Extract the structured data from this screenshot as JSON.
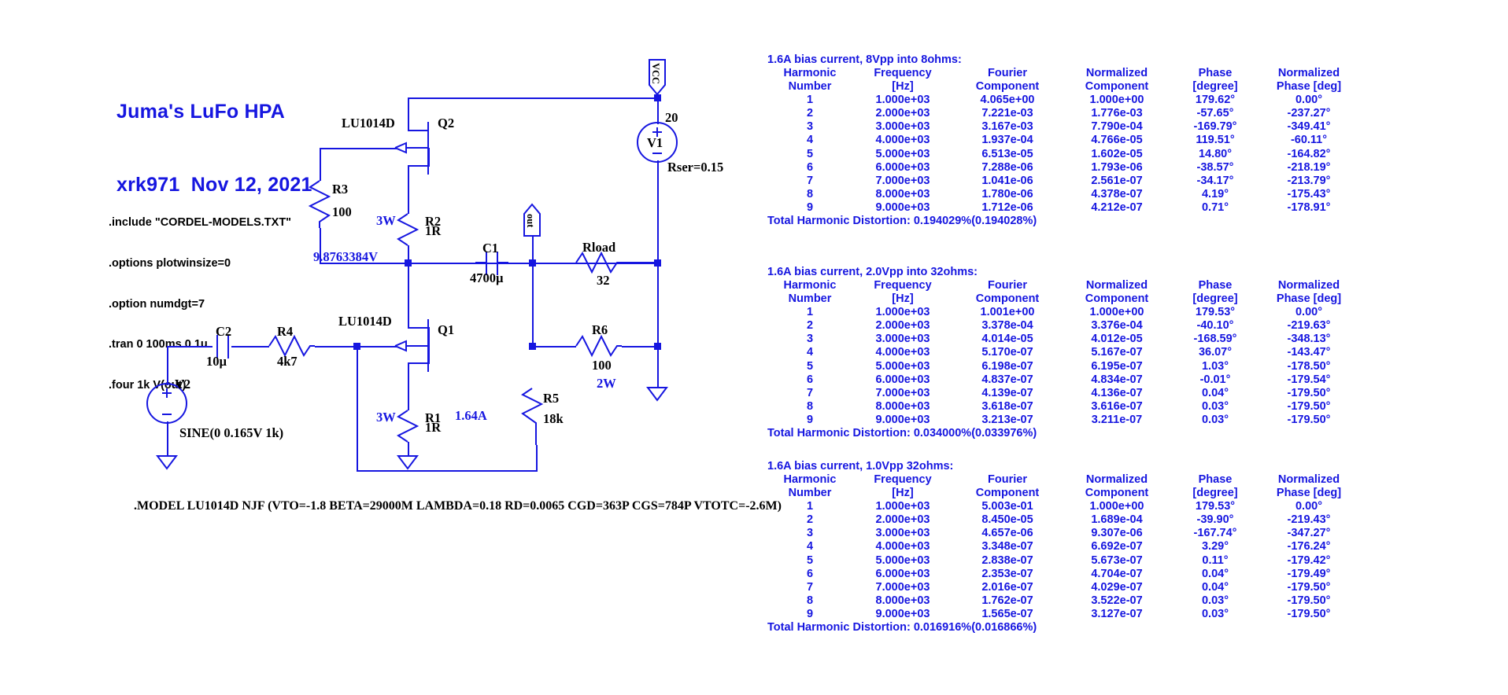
{
  "schematic": {
    "title_line1": "Juma's LuFo HPA",
    "title_line2": "xrk971  Nov 12, 2021",
    "directives": [
      ".include \"CORDEL-MODELS.TXT\"",
      ".options plotwinsize=0",
      ".option numdgt=7",
      ".tran 0 100ms 0 1u",
      ".four 1k V(out)"
    ],
    "model_line": ".MODEL LU1014D NJF (VTO=-1.8 BETA=29000M LAMBDA=0.18 RD=0.0065 CGD=363P CGS=784P VTOTC=-2.6M)",
    "components": {
      "q2_model": "LU1014D",
      "q2_ref": "Q2",
      "q1_model": "LU1014D",
      "q1_ref": "Q1",
      "r3_ref": "R3",
      "r3_val": "100",
      "r2_ref": "R2",
      "r2_val": "1R",
      "r2_power": "3W",
      "r1_ref": "R1",
      "r1_val": "1R",
      "r1_power": "3W",
      "r5_ref": "R5",
      "r5_val": "18k",
      "r6_ref": "R6",
      "r6_val": "100",
      "r6_power": "2W",
      "rload_ref": "Rload",
      "rload_val": "32",
      "c1_ref": "C1",
      "c1_val": "4700µ",
      "c2_ref": "C2",
      "c2_val": "10µ",
      "r4_ref": "R4",
      "r4_val": "4k7",
      "v1_ref": "V1",
      "v1_val": "20",
      "v1_rser": "Rser=0.15",
      "v2_ref": "V2",
      "v2_val": "SINE(0 0.165V 1k)"
    },
    "annotations": {
      "node_voltage": "9.8763384V",
      "bias_current": "1.64A"
    },
    "ports": {
      "vcc": "VCC",
      "out": "out"
    }
  },
  "fourier": {
    "headers_top": [
      "Harmonic",
      "Frequency",
      "Fourier",
      "Normalized",
      "Phase",
      "Normalized"
    ],
    "headers_bottom": [
      "Number",
      "[Hz]",
      "Component",
      "Component",
      "[degree]",
      "Phase [deg]"
    ],
    "tables": [
      {
        "caption": "1.6A bias current, 8Vpp into 8ohms:",
        "rows": [
          [
            "1",
            "1.000e+03",
            "4.065e+00",
            "1.000e+00",
            "179.62°",
            "0.00°"
          ],
          [
            "2",
            "2.000e+03",
            "7.221e-03",
            "1.776e-03",
            "-57.65°",
            "-237.27°"
          ],
          [
            "3",
            "3.000e+03",
            "3.167e-03",
            "7.790e-04",
            "-169.79°",
            "-349.41°"
          ],
          [
            "4",
            "4.000e+03",
            "1.937e-04",
            "4.766e-05",
            "119.51°",
            "-60.11°"
          ],
          [
            "5",
            "5.000e+03",
            "6.513e-05",
            "1.602e-05",
            "14.80°",
            "-164.82°"
          ],
          [
            "6",
            "6.000e+03",
            "7.288e-06",
            "1.793e-06",
            "-38.57°",
            "-218.19°"
          ],
          [
            "7",
            "7.000e+03",
            "1.041e-06",
            "2.561e-07",
            "-34.17°",
            "-213.79°"
          ],
          [
            "8",
            "8.000e+03",
            "1.780e-06",
            "4.378e-07",
            "4.19°",
            "-175.43°"
          ],
          [
            "9",
            "9.000e+03",
            "1.712e-06",
            "4.212e-07",
            "0.71°",
            "-178.91°"
          ]
        ],
        "thd": "Total Harmonic Distortion: 0.194029%(0.194028%)"
      },
      {
        "caption": "1.6A bias current, 2.0Vpp into 32ohms:",
        "rows": [
          [
            "1",
            "1.000e+03",
            "1.001e+00",
            "1.000e+00",
            "179.53°",
            "0.00°"
          ],
          [
            "2",
            "2.000e+03",
            "3.378e-04",
            "3.376e-04",
            "-40.10°",
            "-219.63°"
          ],
          [
            "3",
            "3.000e+03",
            "4.014e-05",
            "4.012e-05",
            "-168.59°",
            "-348.13°"
          ],
          [
            "4",
            "4.000e+03",
            "5.170e-07",
            "5.167e-07",
            "36.07°",
            "-143.47°"
          ],
          [
            "5",
            "5.000e+03",
            "6.198e-07",
            "6.195e-07",
            "1.03°",
            "-178.50°"
          ],
          [
            "6",
            "6.000e+03",
            "4.837e-07",
            "4.834e-07",
            "-0.01°",
            "-179.54°"
          ],
          [
            "7",
            "7.000e+03",
            "4.139e-07",
            "4.136e-07",
            "0.04°",
            "-179.50°"
          ],
          [
            "8",
            "8.000e+03",
            "3.618e-07",
            "3.616e-07",
            "0.03°",
            "-179.50°"
          ],
          [
            "9",
            "9.000e+03",
            "3.213e-07",
            "3.211e-07",
            "0.03°",
            "-179.50°"
          ]
        ],
        "thd": "Total Harmonic Distortion: 0.034000%(0.033976%)"
      },
      {
        "caption": "1.6A bias current, 1.0Vpp 32ohms:",
        "rows": [
          [
            "1",
            "1.000e+03",
            "5.003e-01",
            "1.000e+00",
            "179.53°",
            "0.00°"
          ],
          [
            "2",
            "2.000e+03",
            "8.450e-05",
            "1.689e-04",
            "-39.90°",
            "-219.43°"
          ],
          [
            "3",
            "3.000e+03",
            "4.657e-06",
            "9.307e-06",
            "-167.74°",
            "-347.27°"
          ],
          [
            "4",
            "4.000e+03",
            "3.348e-07",
            "6.692e-07",
            "3.29°",
            "-176.24°"
          ],
          [
            "5",
            "5.000e+03",
            "2.838e-07",
            "5.673e-07",
            "0.11°",
            "-179.42°"
          ],
          [
            "6",
            "6.000e+03",
            "2.353e-07",
            "4.704e-07",
            "0.04°",
            "-179.49°"
          ],
          [
            "7",
            "7.000e+03",
            "2.016e-07",
            "4.029e-07",
            "0.04°",
            "-179.50°"
          ],
          [
            "8",
            "8.000e+03",
            "1.762e-07",
            "3.522e-07",
            "0.03°",
            "-179.50°"
          ],
          [
            "9",
            "9.000e+03",
            "1.565e-07",
            "3.127e-07",
            "0.03°",
            "-179.50°"
          ]
        ],
        "thd": "Total Harmonic Distortion: 0.016916%(0.016866%)"
      }
    ]
  },
  "colors": {
    "wire": "#1616e0",
    "text_black": "#000000",
    "text_blue": "#1616e0"
  }
}
